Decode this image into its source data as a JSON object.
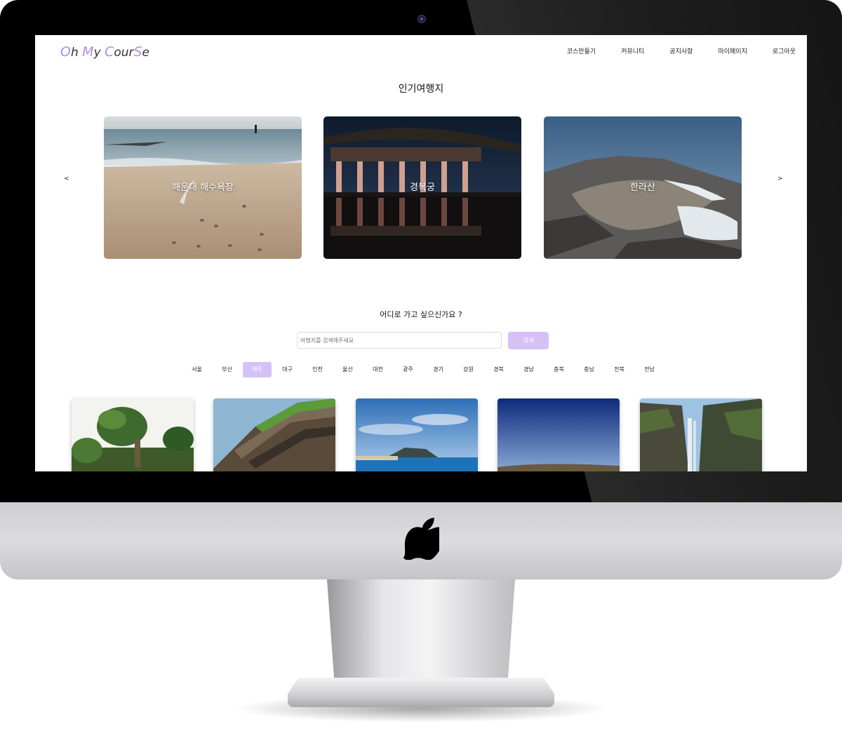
{
  "site": {
    "logo_parts": [
      {
        "t": "O",
        "cap": true
      },
      {
        "t": "h ",
        "cap": false
      },
      {
        "t": "M",
        "cap": true
      },
      {
        "t": "y ",
        "cap": false
      },
      {
        "t": "C",
        "cap": true
      },
      {
        "t": "our",
        "cap": false
      },
      {
        "t": "S",
        "cap": true
      },
      {
        "t": "e",
        "cap": false
      }
    ]
  },
  "nav": [
    "코스만들기",
    "커뮤니티",
    "공지사항",
    "마이페이지",
    "로그아웃"
  ],
  "popular": {
    "title": "인기여행지",
    "prev": "<",
    "next": ">",
    "slides": [
      "해운대 해수욕장",
      "경복궁",
      "한라산"
    ]
  },
  "search": {
    "question": "어디로 가고 싶으신가요 ?",
    "placeholder": "여행지를 검색해주세요",
    "button": "검색"
  },
  "regions": {
    "items": [
      "서울",
      "부산",
      "제주",
      "대구",
      "인천",
      "울산",
      "대전",
      "광주",
      "경기",
      "강원",
      "경북",
      "경남",
      "충북",
      "충남",
      "전북",
      "전남"
    ],
    "selected": "제주"
  },
  "colors": {
    "accent": "#d6c1f7",
    "logo_accent": "#b48be6"
  }
}
